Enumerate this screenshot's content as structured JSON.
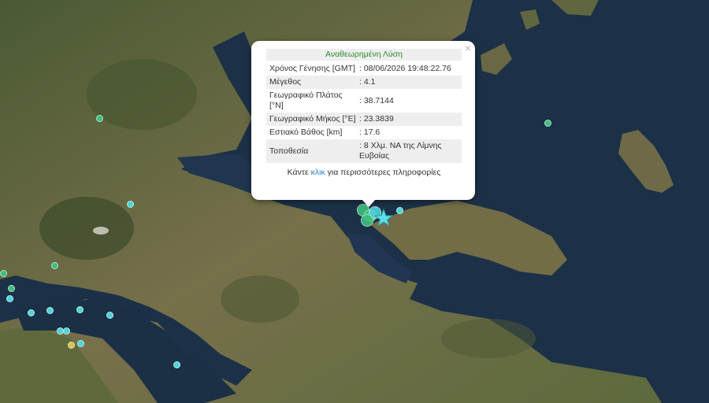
{
  "popup": {
    "title": "Αναθεωρημένη Λύση",
    "close_symbol": "×",
    "rows": [
      {
        "label": "Χρόνος Γένησης [GMT]",
        "value": ": 08/06/2026 19:48:22.76"
      },
      {
        "label": "Μέγεθος",
        "value": ": 4.1"
      },
      {
        "label": "Γεωγραφικό Πλάτος [°N]",
        "value": ": 38.7144"
      },
      {
        "label": "Γεωγραφικό Μήκος [°E]",
        "value": ": 23.3839"
      },
      {
        "label": "Εστιακό Βάθος [km]",
        "value": ": 17.6"
      },
      {
        "label": "Τοποθεσία",
        "value": ": 8 Χλμ. ΝΑ της Λίμνης Ευβοίας"
      }
    ],
    "more_prefix": "Κάντε ",
    "more_link": "κλικ",
    "more_suffix": " για περισσότερες πληροφορίες"
  },
  "colors": {
    "sea": "#1d3248",
    "land": "#6b6a45",
    "land_dark": "#3d4a2a",
    "marker_green": "#3fbf7f",
    "marker_cyan": "#4fd4d8",
    "marker_yellow": "#d9c24a",
    "epicenter": "#5ee0ea"
  },
  "icons": {
    "epicenter": "star-icon",
    "close": "close-icon"
  }
}
